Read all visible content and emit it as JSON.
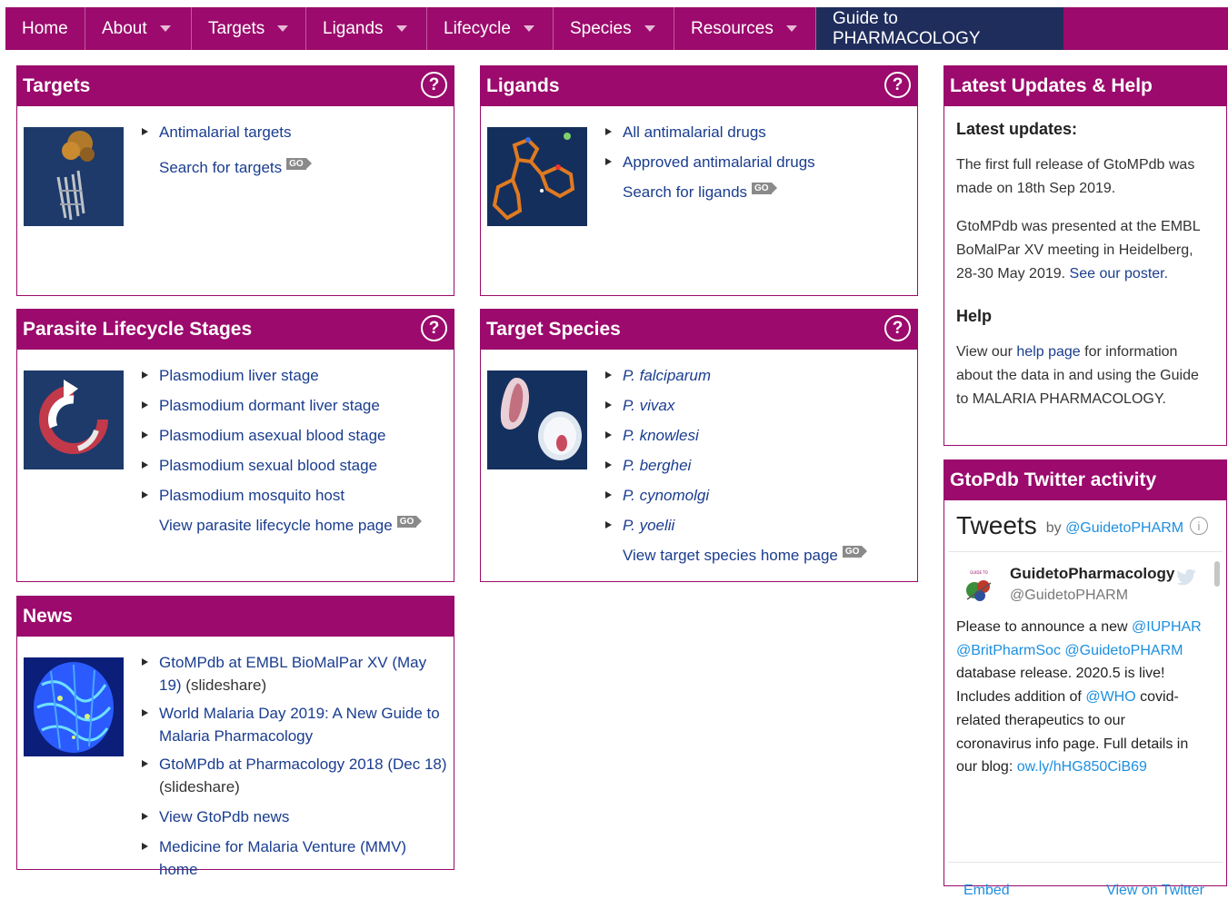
{
  "nav": {
    "items": [
      {
        "label": "Home",
        "caret": false,
        "name": "nav-home"
      },
      {
        "label": "About",
        "caret": true,
        "name": "nav-about"
      },
      {
        "label": "Targets",
        "caret": true,
        "name": "nav-targets"
      },
      {
        "label": "Ligands",
        "caret": true,
        "name": "nav-ligands"
      },
      {
        "label": "Lifecycle",
        "caret": true,
        "name": "nav-lifecycle"
      },
      {
        "label": "Species",
        "caret": true,
        "name": "nav-species"
      },
      {
        "label": "Resources",
        "caret": true,
        "name": "nav-resources"
      },
      {
        "label": "Guide to PHARMACOLOGY",
        "caret": false,
        "name": "nav-guide-to-pharmacology"
      }
    ]
  },
  "go_label": "GO",
  "help_glyph": "?",
  "targets": {
    "title": "Targets",
    "link1": "Antimalarial targets",
    "search": "Search for targets"
  },
  "ligands": {
    "title": "Ligands",
    "link1": "All antimalarial drugs",
    "link2": "Approved antimalarial drugs",
    "search": "Search for ligands"
  },
  "lifecycle": {
    "title": "Parasite Lifecycle Stages",
    "items": [
      "Plasmodium liver stage",
      "Plasmodium dormant liver stage",
      "Plasmodium asexual blood stage",
      "Plasmodium sexual blood stage",
      "Plasmodium mosquito host"
    ],
    "home": "View parasite lifecycle home page"
  },
  "species": {
    "title": "Target Species",
    "items": [
      "P. falciparum",
      "P. vivax",
      "P. knowlesi",
      "P. berghei",
      "P. cynomolgi",
      "P. yoelii"
    ],
    "home": "View target species home page"
  },
  "news": {
    "title": "News",
    "item1_link": "GtoMPdb at EMBL BioMalPar XV (May 19)",
    "item1_note": " (slideshare)",
    "item2_link": "World Malaria Day 2019: A New Guide to Malaria Pharmacology",
    "item3_link": "GtoMPdb at Pharmacology 2018 (Dec 18)",
    "item3_note": " (slideshare)",
    "item4_link": "View GtoPdb news",
    "item5_link": "Medicine for Malaria Venture (MMV) home"
  },
  "updates": {
    "title": "Latest Updates & Help",
    "latest_heading": "Latest updates:",
    "p1": "The first full release of GtoMPdb was made on 18th Sep 2019.",
    "p2_text": "GtoMPdb was presented at the EMBL BoMalPar XV meeting in Heidelberg, 28-30 May 2019. ",
    "p2_link": "See our poster.",
    "help_heading": "Help",
    "help_pre": "View our ",
    "help_link": "help page",
    "help_post": " for information about the data in and using the Guide to MALARIA PHARMACOLOGY."
  },
  "twitter": {
    "title": "GtoPdb Twitter activity",
    "tweets_label": "Tweets",
    "by_label": "by",
    "by_handle": "@GuidetoPHARM",
    "info_glyph": "i",
    "name": "GuidetoPharmacology",
    "handle": "@GuidetoPHARM",
    "t1": "Please to announce a new ",
    "m1": "@IUPHAR",
    "m2": "@BritPharmSoc",
    "m3": "@GuidetoPHARM",
    "t2": " database release. 2020.5 is live! Includes addition of ",
    "m4": "@WHO",
    "t3": " covid-related therapeutics to our coronavirus info page. Full details in our blog: ",
    "url": "ow.ly/hHG850CiB69",
    "embed": "Embed",
    "view": "View on Twitter"
  },
  "colors": {
    "brand": "#9b0a6c",
    "navy": "#1f2d5c",
    "link": "#1a3d8f",
    "twitter": "#1d8fe0"
  }
}
